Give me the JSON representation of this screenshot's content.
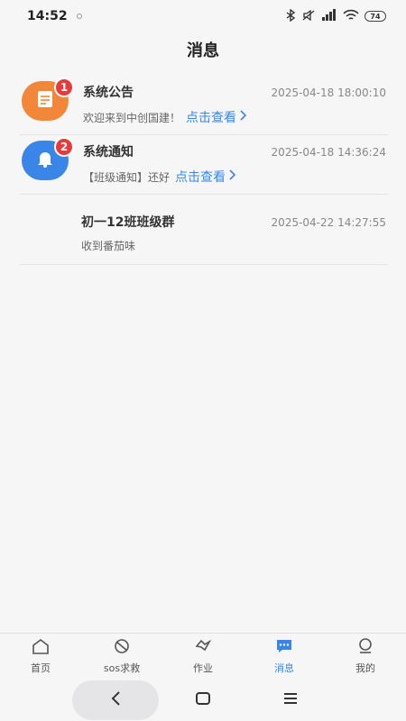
{
  "status": {
    "time": "14:52",
    "battery": "74"
  },
  "header": {
    "title": "消息"
  },
  "messages": [
    {
      "title": "系统公告",
      "time": "2025-04-18 18:00:10",
      "preview": "欢迎来到中创国建！",
      "link": "点击查看",
      "badge": "1",
      "avatar_icon": "document-icon",
      "avatar_color": "#f2873a"
    },
    {
      "title": "系统通知",
      "time": "2025-04-18 14:36:24",
      "preview": "【班级通知】还好",
      "link": "点击查看",
      "badge": "2",
      "avatar_icon": "bell-icon",
      "avatar_color": "#3a86e8"
    },
    {
      "title": "初一12班班级群",
      "time": "2025-04-22 14:27:55",
      "preview": "收到番茄味"
    }
  ],
  "tabs": [
    {
      "label": "首页",
      "icon": "home-icon"
    },
    {
      "label": "sos求救",
      "icon": "sos-icon"
    },
    {
      "label": "作业",
      "icon": "homework-icon"
    },
    {
      "label": "消息",
      "icon": "message-icon",
      "active": true
    },
    {
      "label": "我的",
      "icon": "profile-icon"
    }
  ],
  "colors": {
    "accent": "#3a86e8",
    "badge": "#e83a3a"
  }
}
